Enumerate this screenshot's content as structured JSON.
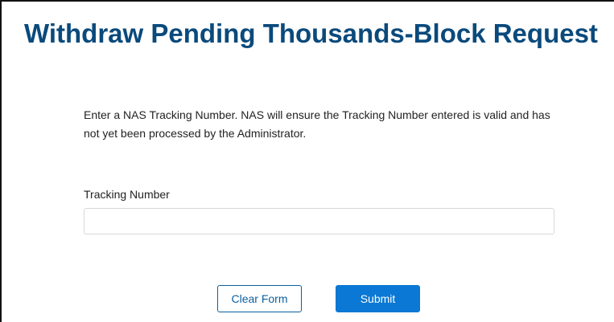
{
  "page": {
    "title": "Withdraw Pending Thousands-Block Request"
  },
  "form": {
    "instructions": "Enter a NAS Tracking Number. NAS will ensure the Tracking Number entered is valid and has not yet been processed by the Administrator.",
    "tracking_number": {
      "label": "Tracking Number",
      "value": "",
      "placeholder": ""
    },
    "buttons": {
      "clear_label": "Clear Form",
      "submit_label": "Submit"
    }
  },
  "colors": {
    "title": "#0a4a7c",
    "primary": "#0a78d4",
    "outline_button": "#0a5f9e",
    "input_border": "#d5d8dc"
  }
}
